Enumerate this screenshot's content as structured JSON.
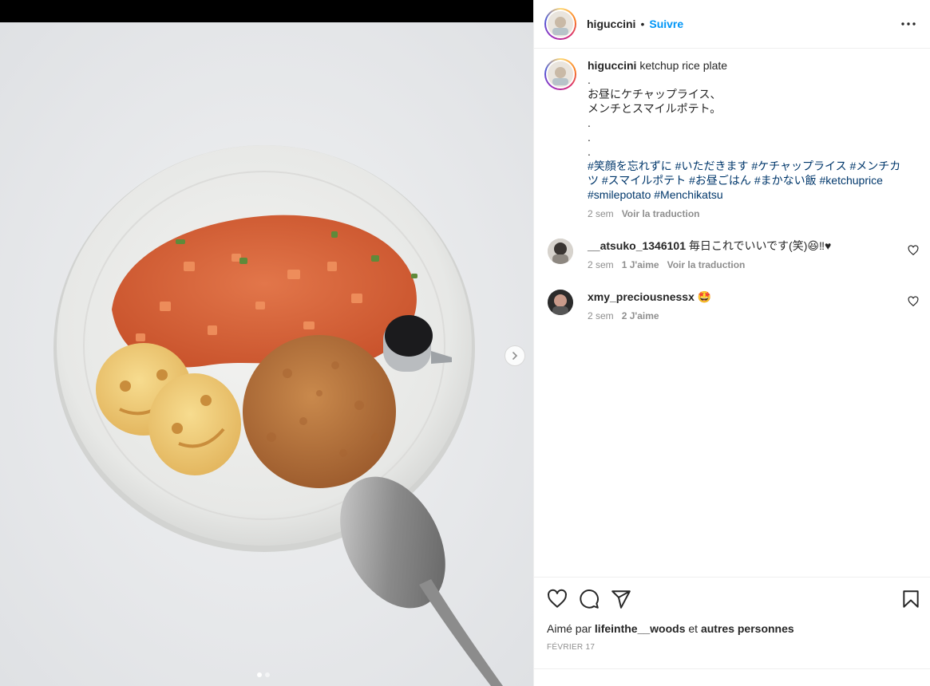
{
  "post": {
    "username": "higuccini",
    "separator": "•",
    "follow_label": "Suivre",
    "image_alt": "ketchup rice plate with menchikatsu and smile potatoes"
  },
  "caption": {
    "username": "higuccini",
    "title": "ketchup rice plate",
    "lines": [
      ".",
      "お昼にケチャップライス、",
      "メンチとスマイルポテト。",
      ".",
      ".",
      "."
    ],
    "hashtags": "#笑顔を忘れずに #いただきます #ケチャップライス #メンチカツ #スマイルポテト #お昼ごはん #まかない飯 #ketchuprice #smilepotato #Menchikatsu",
    "time": "2 sem",
    "translate": "Voir la traduction"
  },
  "comments": [
    {
      "username": "__atsuko_1346101",
      "text": "毎日これでいいです(笑)😆‼︎♥",
      "time": "2 sem",
      "likes": "1 J'aime",
      "translate": "Voir la traduction"
    },
    {
      "username": "xmy_preciousnessx",
      "text": "🤩",
      "time": "2 sem",
      "likes": "2 J'aime"
    }
  ],
  "actions": {
    "liked_prefix": "Aimé par",
    "liked_user": "lifeinthe__woods",
    "liked_and": "et",
    "liked_others": "autres personnes",
    "date": "FÉVRIER 17"
  },
  "icons": {
    "more": "more-options-icon",
    "like": "heart-icon",
    "comment": "comment-icon",
    "share": "share-icon",
    "save": "bookmark-icon",
    "next": "chevron-right-icon"
  },
  "colors": {
    "link_blue": "#0095f6",
    "hashtag": "#00376b",
    "muted": "#8e8e8e",
    "text": "#262626"
  },
  "carousel": {
    "current": 1,
    "total": 2
  }
}
